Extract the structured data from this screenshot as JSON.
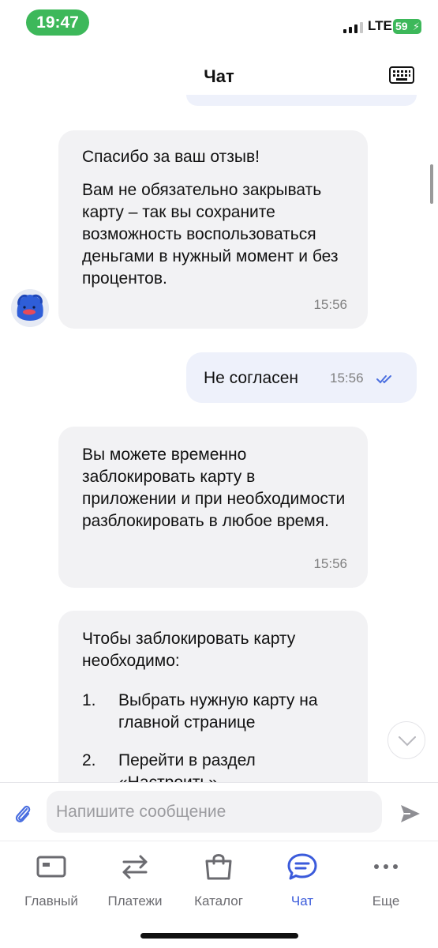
{
  "status_bar": {
    "time": "19:47",
    "network": "LTE",
    "battery": "59"
  },
  "header": {
    "title": "Чат",
    "keyboard_icon": "keyboard-icon"
  },
  "messages": [
    {
      "from": "bot",
      "paragraphs": [
        "Спасибо за ваш отзыв!",
        "Вам не обязательно закрывать карту – так вы сохраните возможность воспользоваться деньгами в нужный момент и без процентов."
      ],
      "time": "15:56"
    },
    {
      "from": "user",
      "text": "Не согласен",
      "time": "15:56",
      "status_icon": "double-check-icon"
    },
    {
      "from": "bot",
      "text": "Вы можете временно заблокировать карту в приложении и при необходимости разблокировать в любое время.",
      "time": "15:56"
    },
    {
      "from": "bot",
      "lead": "Чтобы заблокировать карту необходимо:",
      "steps": [
        {
          "num": "1.",
          "text": "Выбрать нужную карту на главной странице"
        },
        {
          "num": "2.",
          "text": "Перейти в раздел «Настроить»"
        }
      ]
    }
  ],
  "composer": {
    "placeholder": "Напишите сообщение"
  },
  "tabs": [
    {
      "label": "Главный",
      "icon": "card-icon"
    },
    {
      "label": "Платежи",
      "icon": "transfer-arrows-icon"
    },
    {
      "label": "Каталог",
      "icon": "shopping-bag-icon"
    },
    {
      "label": "Чат",
      "icon": "chat-bubble-icon",
      "active": true
    },
    {
      "label": "Еще",
      "icon": "more-dots-icon"
    }
  ],
  "colors": {
    "accent": "#3b5bdb",
    "status_green": "#3db85a",
    "bubble_in": "#f2f2f4",
    "bubble_out": "#eef1fb"
  }
}
